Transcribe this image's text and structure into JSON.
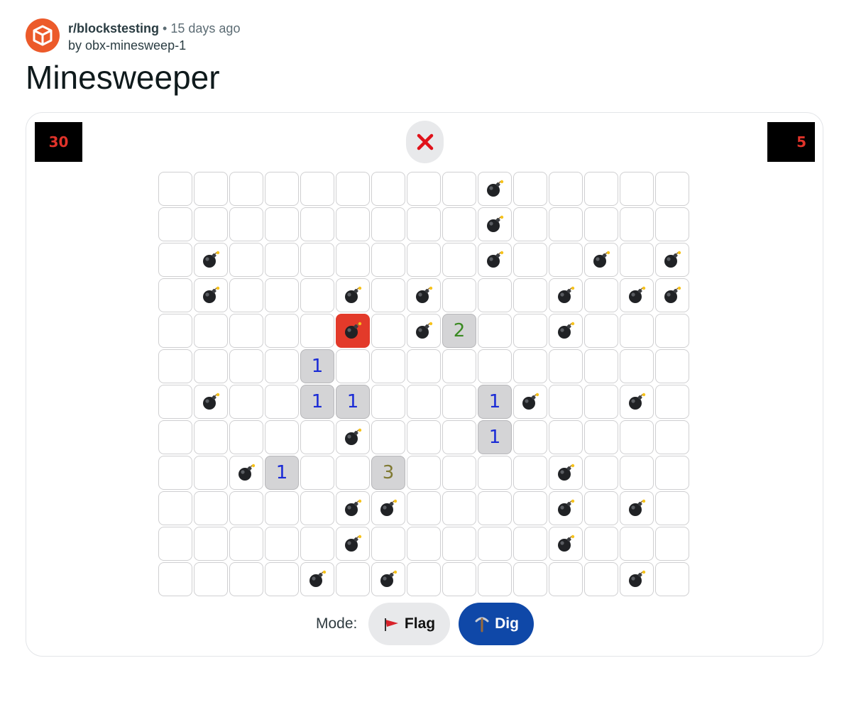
{
  "post": {
    "subreddit": "r/blockstesting",
    "separator": "•",
    "time_ago": "15 days ago",
    "author": "by obx-minesweep-1",
    "title": "Minesweeper",
    "avatar_icon": "cube-icon",
    "avatar_color": "#ec5a2a"
  },
  "game": {
    "mines_remaining": "30",
    "timer": "5",
    "status_icon": "red-x-icon",
    "status": "lost",
    "board": {
      "columns": 15,
      "rows": 12,
      "cells": [
        "         M     ",
        "         M     ",
        " M       M  M M",
        " M   M M   M MM ",
        "     X M2  M    ",
        "    1          ",
        " M  11   1M  M  ",
        "     M   1     ",
        "  M1  3    M   ",
        "     MM    M M  ",
        "     M     M   ",
        "    M M      M "
      ],
      "legend": {
        "M": "mine",
        "X": "exploded-mine",
        "1-8": "revealed-number",
        " ": "hidden"
      }
    },
    "number_colors": {
      "1": "#1a2bd6",
      "2": "#3a8a22",
      "3": "#807a33"
    },
    "exploded_color": "#e33a2a"
  },
  "controls": {
    "mode_label": "Mode:",
    "flag_label": "Flag",
    "flag_icon": "red-flag-icon",
    "dig_label": "Dig",
    "dig_icon": "pickaxe-icon",
    "active_mode": "Dig"
  }
}
